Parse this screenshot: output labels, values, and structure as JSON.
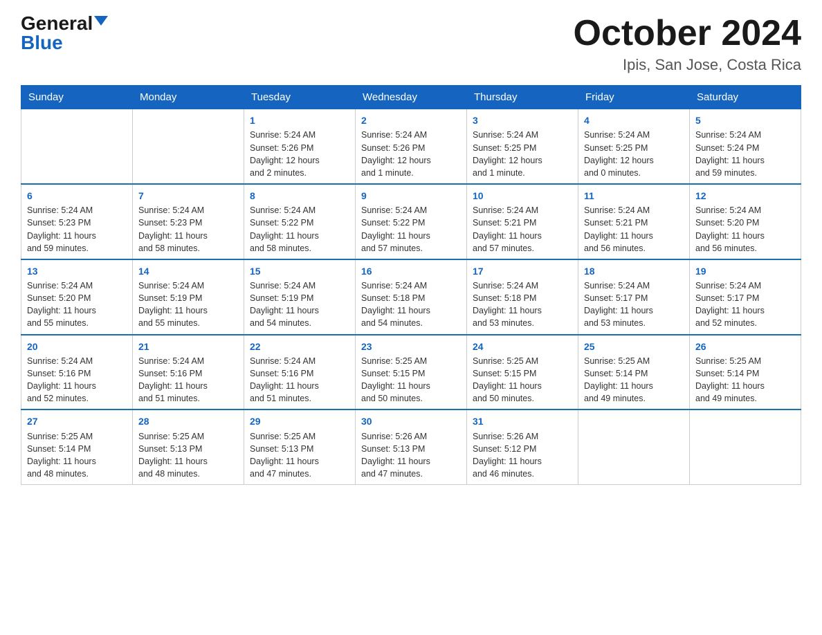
{
  "logo": {
    "general": "General",
    "blue": "Blue"
  },
  "title": {
    "month": "October 2024",
    "location": "Ipis, San Jose, Costa Rica"
  },
  "days_header": [
    "Sunday",
    "Monday",
    "Tuesday",
    "Wednesday",
    "Thursday",
    "Friday",
    "Saturday"
  ],
  "weeks": [
    [
      {
        "day": "",
        "info": ""
      },
      {
        "day": "",
        "info": ""
      },
      {
        "day": "1",
        "info": "Sunrise: 5:24 AM\nSunset: 5:26 PM\nDaylight: 12 hours\nand 2 minutes."
      },
      {
        "day": "2",
        "info": "Sunrise: 5:24 AM\nSunset: 5:26 PM\nDaylight: 12 hours\nand 1 minute."
      },
      {
        "day": "3",
        "info": "Sunrise: 5:24 AM\nSunset: 5:25 PM\nDaylight: 12 hours\nand 1 minute."
      },
      {
        "day": "4",
        "info": "Sunrise: 5:24 AM\nSunset: 5:25 PM\nDaylight: 12 hours\nand 0 minutes."
      },
      {
        "day": "5",
        "info": "Sunrise: 5:24 AM\nSunset: 5:24 PM\nDaylight: 11 hours\nand 59 minutes."
      }
    ],
    [
      {
        "day": "6",
        "info": "Sunrise: 5:24 AM\nSunset: 5:23 PM\nDaylight: 11 hours\nand 59 minutes."
      },
      {
        "day": "7",
        "info": "Sunrise: 5:24 AM\nSunset: 5:23 PM\nDaylight: 11 hours\nand 58 minutes."
      },
      {
        "day": "8",
        "info": "Sunrise: 5:24 AM\nSunset: 5:22 PM\nDaylight: 11 hours\nand 58 minutes."
      },
      {
        "day": "9",
        "info": "Sunrise: 5:24 AM\nSunset: 5:22 PM\nDaylight: 11 hours\nand 57 minutes."
      },
      {
        "day": "10",
        "info": "Sunrise: 5:24 AM\nSunset: 5:21 PM\nDaylight: 11 hours\nand 57 minutes."
      },
      {
        "day": "11",
        "info": "Sunrise: 5:24 AM\nSunset: 5:21 PM\nDaylight: 11 hours\nand 56 minutes."
      },
      {
        "day": "12",
        "info": "Sunrise: 5:24 AM\nSunset: 5:20 PM\nDaylight: 11 hours\nand 56 minutes."
      }
    ],
    [
      {
        "day": "13",
        "info": "Sunrise: 5:24 AM\nSunset: 5:20 PM\nDaylight: 11 hours\nand 55 minutes."
      },
      {
        "day": "14",
        "info": "Sunrise: 5:24 AM\nSunset: 5:19 PM\nDaylight: 11 hours\nand 55 minutes."
      },
      {
        "day": "15",
        "info": "Sunrise: 5:24 AM\nSunset: 5:19 PM\nDaylight: 11 hours\nand 54 minutes."
      },
      {
        "day": "16",
        "info": "Sunrise: 5:24 AM\nSunset: 5:18 PM\nDaylight: 11 hours\nand 54 minutes."
      },
      {
        "day": "17",
        "info": "Sunrise: 5:24 AM\nSunset: 5:18 PM\nDaylight: 11 hours\nand 53 minutes."
      },
      {
        "day": "18",
        "info": "Sunrise: 5:24 AM\nSunset: 5:17 PM\nDaylight: 11 hours\nand 53 minutes."
      },
      {
        "day": "19",
        "info": "Sunrise: 5:24 AM\nSunset: 5:17 PM\nDaylight: 11 hours\nand 52 minutes."
      }
    ],
    [
      {
        "day": "20",
        "info": "Sunrise: 5:24 AM\nSunset: 5:16 PM\nDaylight: 11 hours\nand 52 minutes."
      },
      {
        "day": "21",
        "info": "Sunrise: 5:24 AM\nSunset: 5:16 PM\nDaylight: 11 hours\nand 51 minutes."
      },
      {
        "day": "22",
        "info": "Sunrise: 5:24 AM\nSunset: 5:16 PM\nDaylight: 11 hours\nand 51 minutes."
      },
      {
        "day": "23",
        "info": "Sunrise: 5:25 AM\nSunset: 5:15 PM\nDaylight: 11 hours\nand 50 minutes."
      },
      {
        "day": "24",
        "info": "Sunrise: 5:25 AM\nSunset: 5:15 PM\nDaylight: 11 hours\nand 50 minutes."
      },
      {
        "day": "25",
        "info": "Sunrise: 5:25 AM\nSunset: 5:14 PM\nDaylight: 11 hours\nand 49 minutes."
      },
      {
        "day": "26",
        "info": "Sunrise: 5:25 AM\nSunset: 5:14 PM\nDaylight: 11 hours\nand 49 minutes."
      }
    ],
    [
      {
        "day": "27",
        "info": "Sunrise: 5:25 AM\nSunset: 5:14 PM\nDaylight: 11 hours\nand 48 minutes."
      },
      {
        "day": "28",
        "info": "Sunrise: 5:25 AM\nSunset: 5:13 PM\nDaylight: 11 hours\nand 48 minutes."
      },
      {
        "day": "29",
        "info": "Sunrise: 5:25 AM\nSunset: 5:13 PM\nDaylight: 11 hours\nand 47 minutes."
      },
      {
        "day": "30",
        "info": "Sunrise: 5:26 AM\nSunset: 5:13 PM\nDaylight: 11 hours\nand 47 minutes."
      },
      {
        "day": "31",
        "info": "Sunrise: 5:26 AM\nSunset: 5:12 PM\nDaylight: 11 hours\nand 46 minutes."
      },
      {
        "day": "",
        "info": ""
      },
      {
        "day": "",
        "info": ""
      }
    ]
  ]
}
